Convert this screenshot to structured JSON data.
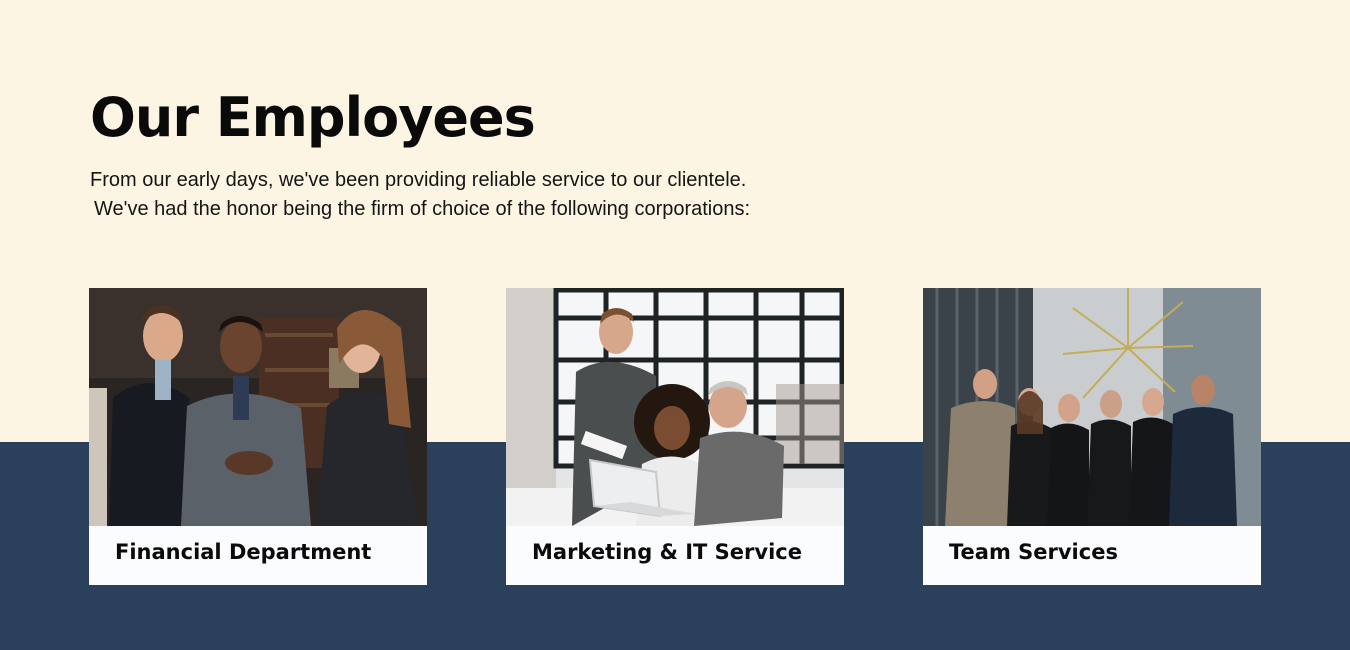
{
  "section": {
    "title": "Our Employees",
    "intro_line1": "From our early days, we've been providing reliable service to our clientele.",
    "intro_line2": "We've had the honor being the firm of choice of the following corporations:"
  },
  "cards": [
    {
      "label": "Financial Department"
    },
    {
      "label": "Marketing & IT Service"
    },
    {
      "label": "Team Services"
    }
  ],
  "colors": {
    "background": "#fdf5e4",
    "band": "#2b405a",
    "card": "#fbfcfe",
    "text": "#0a0a0a"
  }
}
